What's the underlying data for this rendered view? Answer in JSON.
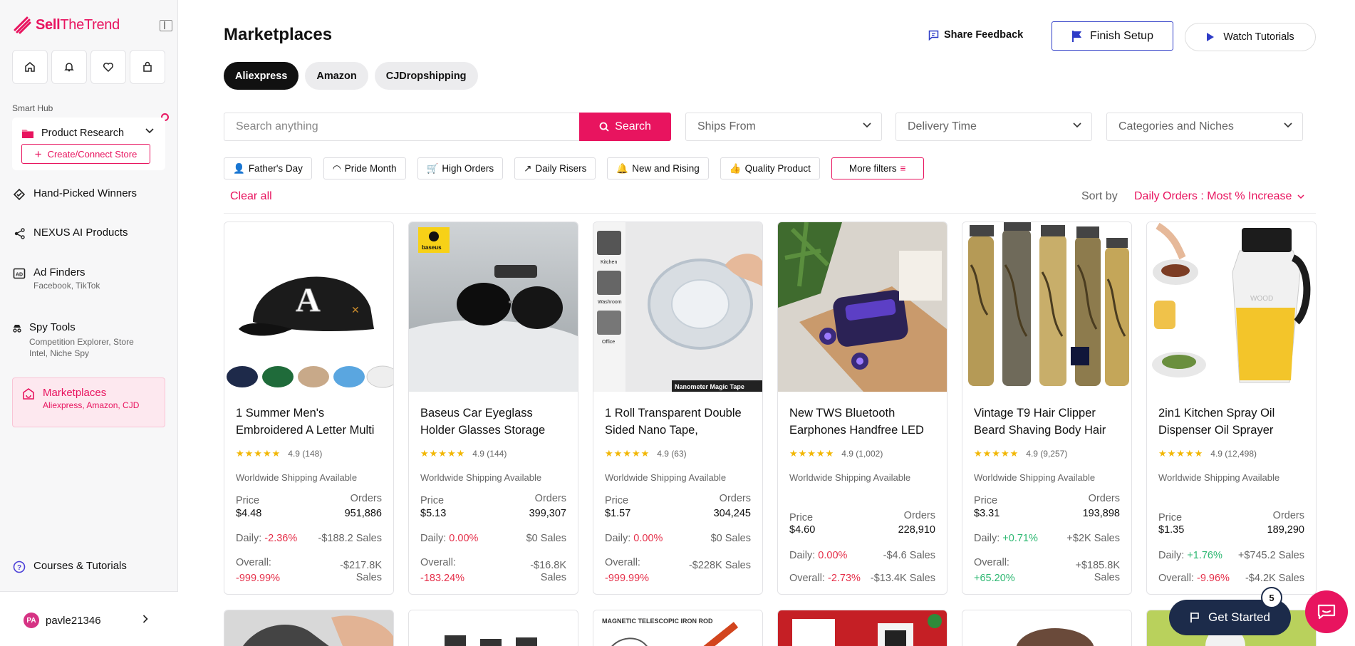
{
  "brand": {
    "name_part1": "Sell",
    "name_part2": "TheTrend",
    "accent": "#e8145f"
  },
  "sidebar": {
    "quick_icons": [
      "home-icon",
      "bell-icon",
      "heart-icon",
      "bag-icon"
    ],
    "smart_hub_label": "Smart Hub",
    "product_research": {
      "label": "Product Research",
      "create_label": "Create/Connect Store"
    },
    "items": [
      {
        "label": "Hand-Picked Winners",
        "sub": ""
      },
      {
        "label": "NEXUS AI Products",
        "sub": ""
      },
      {
        "label": "Ad Finders",
        "sub": "Facebook, TikTok"
      },
      {
        "label": "Spy Tools",
        "sub": "Competition Explorer, Store Intel, Niche Spy"
      },
      {
        "label": "Marketplaces",
        "sub": "Aliexpress, Amazon, CJD"
      },
      {
        "label": "Courses & Tutorials",
        "sub": ""
      }
    ],
    "user": {
      "initials": "PA",
      "name": "pavle21346"
    }
  },
  "header": {
    "title": "Marketplaces",
    "share_feedback": "Share Feedback",
    "finish_setup": "Finish Setup",
    "watch_tutorials": "Watch Tutorials"
  },
  "tabs": [
    "Aliexpress",
    "Amazon",
    "CJDropshipping"
  ],
  "search": {
    "placeholder": "Search anything",
    "button": "Search"
  },
  "dropdowns": [
    "Ships From",
    "Delivery Time",
    "Categories and Niches"
  ],
  "chips": [
    "Father's Day",
    "Pride Month",
    "High Orders",
    "Daily Risers",
    "New and Rising",
    "Quality Product",
    "More filters"
  ],
  "clear_all": "Clear all",
  "sort": {
    "label": "Sort by",
    "value": "Daily Orders : Most % Increase"
  },
  "labels": {
    "shipping": "Worldwide Shipping Available",
    "price": "Price",
    "orders": "Orders",
    "daily": "Daily:",
    "overall": "Overall:"
  },
  "products": [
    {
      "title": "1 Summer Men's Embroidered A Letter Multi",
      "rating": "4.9 (148)",
      "price": "$4.48",
      "orders": "951,886",
      "daily_pct": "-2.36%",
      "daily_sales": "-$188.2 Sales",
      "overall_pct": "-999.99%",
      "overall_sales": "-$217.8K Sales"
    },
    {
      "title": "Baseus Car Eyeglass Holder Glasses Storage",
      "rating": "4.9 (144)",
      "price": "$5.13",
      "orders": "399,307",
      "daily_pct": "0.00%",
      "daily_sales": "$0 Sales",
      "overall_pct": "-183.24%",
      "overall_sales": "-$16.8K Sales"
    },
    {
      "title": "1 Roll Transparent Double Sided Nano Tape,",
      "rating": "4.9 (63)",
      "price": "$1.57",
      "orders": "304,245",
      "daily_pct": "0.00%",
      "daily_sales": "$0 Sales",
      "overall_pct": "-999.99%",
      "overall_sales": "-$228K Sales"
    },
    {
      "title": "New TWS Bluetooth Earphones Handfree LED",
      "rating": "4.9 (1,002)",
      "price": "$4.60",
      "orders": "228,910",
      "daily_pct": "0.00%",
      "daily_sales": "-$4.6 Sales",
      "overall_pct": "-2.73%",
      "overall_sales": "-$13.4K Sales"
    },
    {
      "title": "Vintage T9 Hair Clipper Beard Shaving Body Hair",
      "rating": "4.9 (9,257)",
      "price": "$3.31",
      "orders": "193,898",
      "daily_pct": "+0.71%",
      "daily_sales": "+$2K Sales",
      "overall_pct": "+65.20%",
      "overall_sales": "+$185.8K Sales"
    },
    {
      "title": "2in1 Kitchen Spray Oil Dispenser Oil Sprayer",
      "rating": "4.9 (12,498)",
      "price": "$1.35",
      "orders": "189,290",
      "daily_pct": "+1.76%",
      "daily_sales": "+$745.2 Sales",
      "overall_pct": "-9.96%",
      "overall_sales": "-$4.2K Sales"
    }
  ],
  "image_texts": {
    "baseus_logo": "baseus",
    "tape_caption": "Nanometer Magic Tape",
    "tape_labels": [
      "Kitchen",
      "Washroom",
      "Office"
    ],
    "oil_brand": "WOOD",
    "magnetic_rod": "MAGNETIC TELESCOPIC IRON ROD"
  },
  "get_started": {
    "label": "Get Started",
    "badge": "5"
  }
}
